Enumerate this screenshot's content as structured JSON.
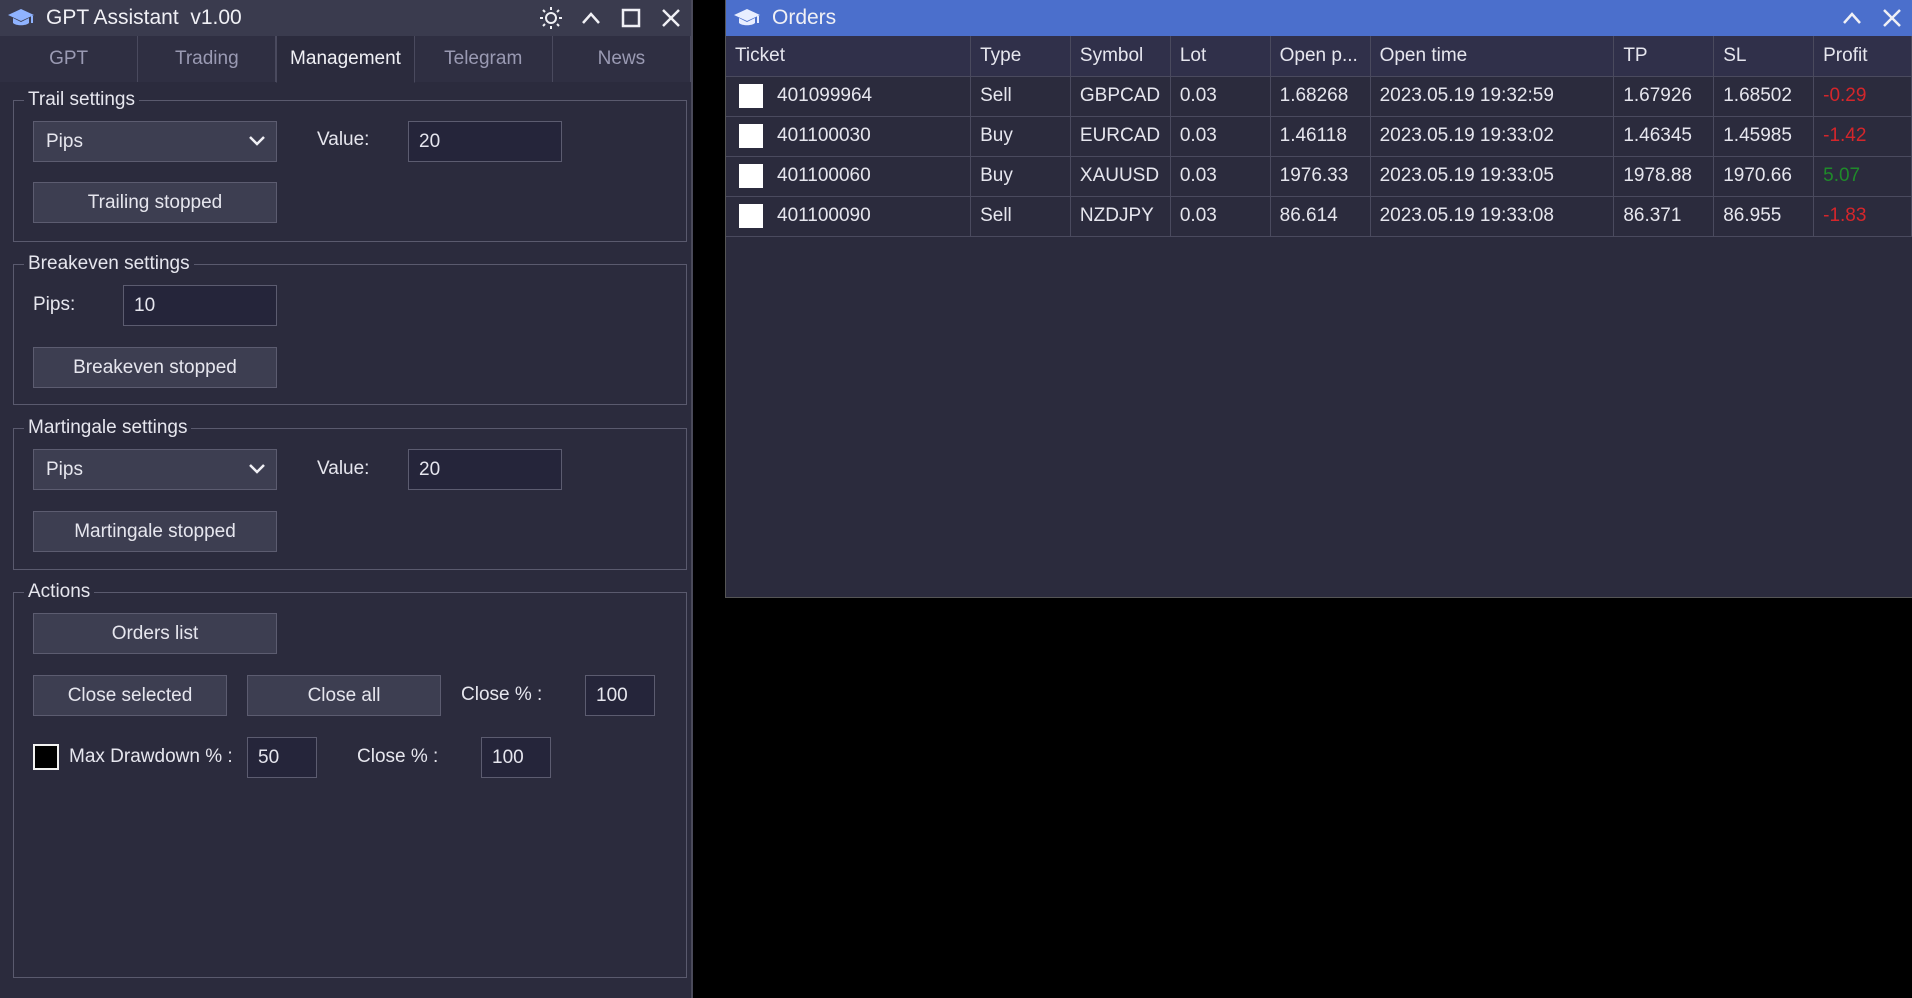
{
  "main_window": {
    "title": "GPT Assistant  v1.00",
    "tabs": [
      {
        "label": "GPT"
      },
      {
        "label": "Trading"
      },
      {
        "label": "Management"
      },
      {
        "label": "Telegram"
      },
      {
        "label": "News"
      }
    ],
    "active_tab": "Management",
    "trail": {
      "legend": "Trail settings",
      "mode": "Pips",
      "value_label": "Value:",
      "value": "20",
      "button": "Trailing stopped"
    },
    "breakeven": {
      "legend": "Breakeven settings",
      "pips_label": "Pips:",
      "pips": "10",
      "button": "Breakeven stopped"
    },
    "martingale": {
      "legend": "Martingale settings",
      "mode": "Pips",
      "value_label": "Value:",
      "value": "20",
      "button": "Martingale stopped"
    },
    "actions": {
      "legend": "Actions",
      "orders_list": "Orders list",
      "close_selected": "Close selected",
      "close_all": "Close all",
      "close_pct_label": "Close % :",
      "close_pct": "100",
      "max_dd_label": "Max Drawdown % :",
      "max_dd": "50",
      "max_dd_checked": false,
      "dd_close_pct_label": "Close % :",
      "dd_close_pct": "100"
    }
  },
  "orders_window": {
    "title": "Orders",
    "columns": [
      "Ticket",
      "Type",
      "Symbol",
      "Lot",
      "Open p...",
      "Open time",
      "TP",
      "SL",
      "Profit"
    ],
    "rows": [
      {
        "ticket": "401099964",
        "type": "Sell",
        "symbol": "GBPCAD",
        "lot": "0.03",
        "open_price": "1.68268",
        "open_time": "2023.05.19 19:32:59",
        "tp": "1.67926",
        "sl": "1.68502",
        "profit": "-0.29"
      },
      {
        "ticket": "401100030",
        "type": "Buy",
        "symbol": "EURCAD",
        "lot": "0.03",
        "open_price": "1.46118",
        "open_time": "2023.05.19 19:33:02",
        "tp": "1.46345",
        "sl": "1.45985",
        "profit": "-1.42"
      },
      {
        "ticket": "401100060",
        "type": "Buy",
        "symbol": "XAUUSD",
        "lot": "0.03",
        "open_price": "1976.33",
        "open_time": "2023.05.19 19:33:05",
        "tp": "1978.88",
        "sl": "1970.66",
        "profit": "5.07"
      },
      {
        "ticket": "401100090",
        "type": "Sell",
        "symbol": "NZDJPY",
        "lot": "0.03",
        "open_price": "86.614",
        "open_time": "2023.05.19 19:33:08",
        "tp": "86.371",
        "sl": "86.955",
        "profit": "-1.83"
      }
    ],
    "colors": {
      "loss": "#d4262b",
      "gain": "#1f8a2a"
    }
  },
  "icons": {
    "app": "graduation-cap-icon",
    "theme": "sun-icon",
    "minimize": "chevron-up-icon",
    "maximize": "square-icon",
    "close": "close-icon",
    "dropdown": "chevron-down-icon"
  }
}
